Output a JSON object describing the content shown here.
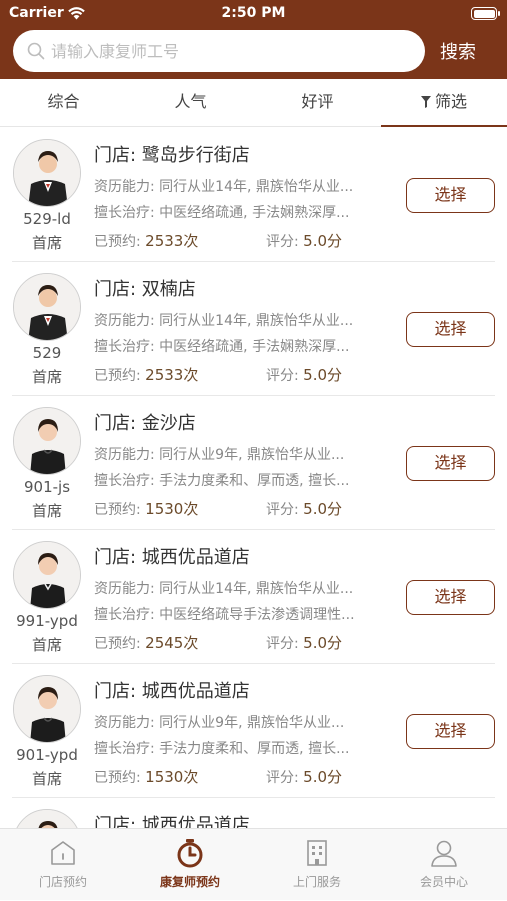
{
  "status_bar": {
    "carrier": "Carrier",
    "time": "2:50 PM"
  },
  "search": {
    "placeholder": "请输入康复师工号",
    "button": "搜索"
  },
  "tabs": [
    {
      "label": "综合",
      "active": false
    },
    {
      "label": "人气",
      "active": false
    },
    {
      "label": "好评",
      "active": false
    },
    {
      "label": "筛选",
      "active": true,
      "icon": "filter-icon"
    }
  ],
  "therapists": [
    {
      "code": "529-ld",
      "level": "首席",
      "store": "门店: 鹭岛步行街店",
      "experience": "资历能力: 同行从业14年, 鼎族怡华从业...",
      "specialty": "擅长治疗: 中医经络疏通, 手法娴熟深厚...",
      "booked_label": "已预约:",
      "booked": "2533次",
      "rating_label": "评分:",
      "rating": "5.0分",
      "select": "选择"
    },
    {
      "code": "529",
      "level": "首席",
      "store": "门店: 双楠店",
      "experience": "资历能力: 同行从业14年, 鼎族怡华从业...",
      "specialty": "擅长治疗: 中医经络疏通, 手法娴熟深厚...",
      "booked_label": "已预约:",
      "booked": "2533次",
      "rating_label": "评分:",
      "rating": "5.0分",
      "select": "选择"
    },
    {
      "code": "901-js",
      "level": "首席",
      "store": "门店: 金沙店",
      "experience": "资历能力: 同行从业9年, 鼎族怡华从业...",
      "specialty": "擅长治疗: 手法力度柔和、厚而透, 擅长...",
      "booked_label": "已预约:",
      "booked": "1530次",
      "rating_label": "评分:",
      "rating": "5.0分",
      "select": "选择"
    },
    {
      "code": "991-ypd",
      "level": "首席",
      "store": "门店: 城西优品道店",
      "experience": "资历能力: 同行从业14年, 鼎族怡华从业...",
      "specialty": "擅长治疗: 中医经络疏导手法渗透调理性...",
      "booked_label": "已预约:",
      "booked": "2545次",
      "rating_label": "评分:",
      "rating": "5.0分",
      "select": "选择"
    },
    {
      "code": "901-ypd",
      "level": "首席",
      "store": "门店: 城西优品道店",
      "experience": "资历能力: 同行从业9年, 鼎族怡华从业...",
      "specialty": "擅长治疗: 手法力度柔和、厚而透, 擅长...",
      "booked_label": "已预约:",
      "booked": "1530次",
      "rating_label": "评分:",
      "rating": "5.0分",
      "select": "选择"
    },
    {
      "code": "",
      "level": "",
      "store": "门店: 城西优品道店",
      "experience": "",
      "specialty": "",
      "booked_label": "",
      "booked": "",
      "rating_label": "",
      "rating": "",
      "select": ""
    }
  ],
  "tabbar": [
    {
      "label": "门店预约",
      "icon": "store-icon",
      "active": false
    },
    {
      "label": "康复师预约",
      "icon": "timer-icon",
      "active": true
    },
    {
      "label": "上门服务",
      "icon": "building-icon",
      "active": false
    },
    {
      "label": "会员中心",
      "icon": "user-icon",
      "active": false
    }
  ],
  "colors": {
    "brand": "#7b3519",
    "accent_text": "#6b4a2a"
  }
}
